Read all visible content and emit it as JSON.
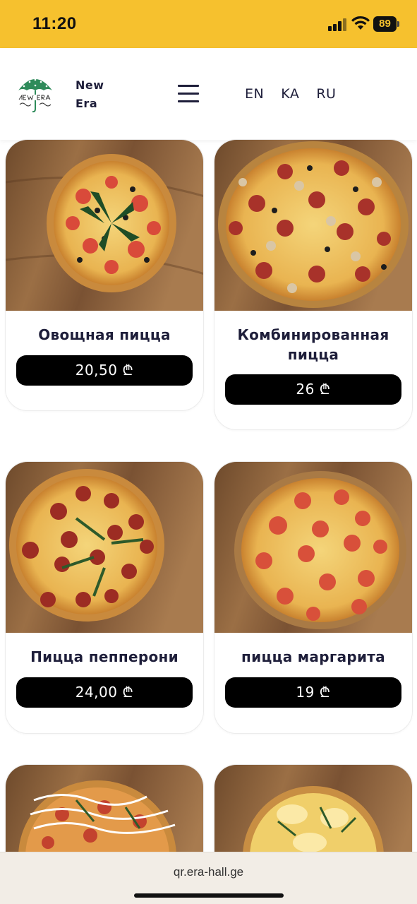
{
  "status_bar": {
    "time": "11:20",
    "battery": "89",
    "background_color": "#f6c12e"
  },
  "header": {
    "brand_line1": "New",
    "brand_line2": "Era",
    "logo_icon": "umbrella-logo-icon",
    "menu_icon": "hamburger-menu-icon",
    "languages": [
      "EN",
      "KA",
      "RU"
    ]
  },
  "products": [
    {
      "name": "Овощная пицца",
      "price": "20,50 ₾",
      "image_icon": "vegetable-pizza-photo"
    },
    {
      "name": "Комбинированная пицца",
      "price": "26 ₾",
      "image_icon": "combined-pizza-photo"
    },
    {
      "name": "Пицца пепперони",
      "price": "24,00 ₾",
      "image_icon": "pepperoni-pizza-photo"
    },
    {
      "name": "пицца маргарита",
      "price": "19 ₾",
      "image_icon": "margherita-pizza-photo"
    },
    {
      "name": "",
      "price": "",
      "image_icon": "pizza-photo"
    },
    {
      "name": "",
      "price": "",
      "image_icon": "pizza-photo"
    }
  ],
  "browser": {
    "url": "qr.era-hall.ge"
  },
  "colors": {
    "accent": "#f6c12e",
    "text": "#1e1e3a",
    "price_button": "#000000"
  }
}
